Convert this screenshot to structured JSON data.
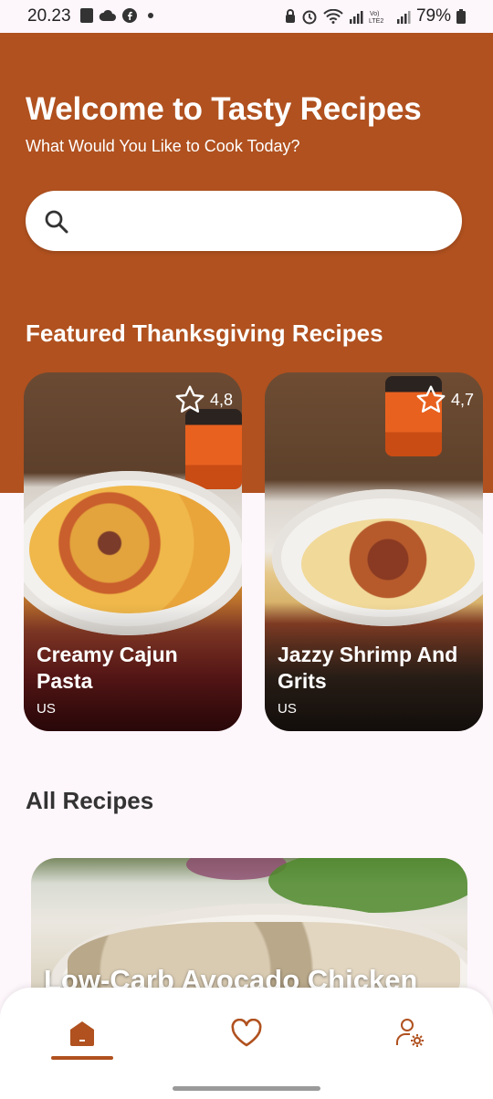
{
  "status_bar": {
    "time": "20.23",
    "battery": "79%"
  },
  "header": {
    "title": "Welcome to Tasty Recipes",
    "subtitle": "What Would You Like to Cook Today?"
  },
  "search": {
    "placeholder": "",
    "value": ""
  },
  "featured": {
    "title": "Featured Thanksgiving Recipes",
    "cards": [
      {
        "title": "Creamy Cajun Pasta",
        "country": "US",
        "rating": "4,8"
      },
      {
        "title": "Jazzy Shrimp And Grits",
        "country": "US",
        "rating": "4,7"
      }
    ]
  },
  "all_recipes": {
    "title": "All Recipes",
    "items": [
      {
        "title": "Low-Carb Avocado Chicken"
      }
    ]
  },
  "bottom_nav": {
    "items": [
      {
        "icon": "home-icon",
        "active": true
      },
      {
        "icon": "heart-icon",
        "active": false
      },
      {
        "icon": "user-settings-icon",
        "active": false
      }
    ]
  },
  "colors": {
    "brand": "#b0511f",
    "background": "#fdf6fb"
  }
}
